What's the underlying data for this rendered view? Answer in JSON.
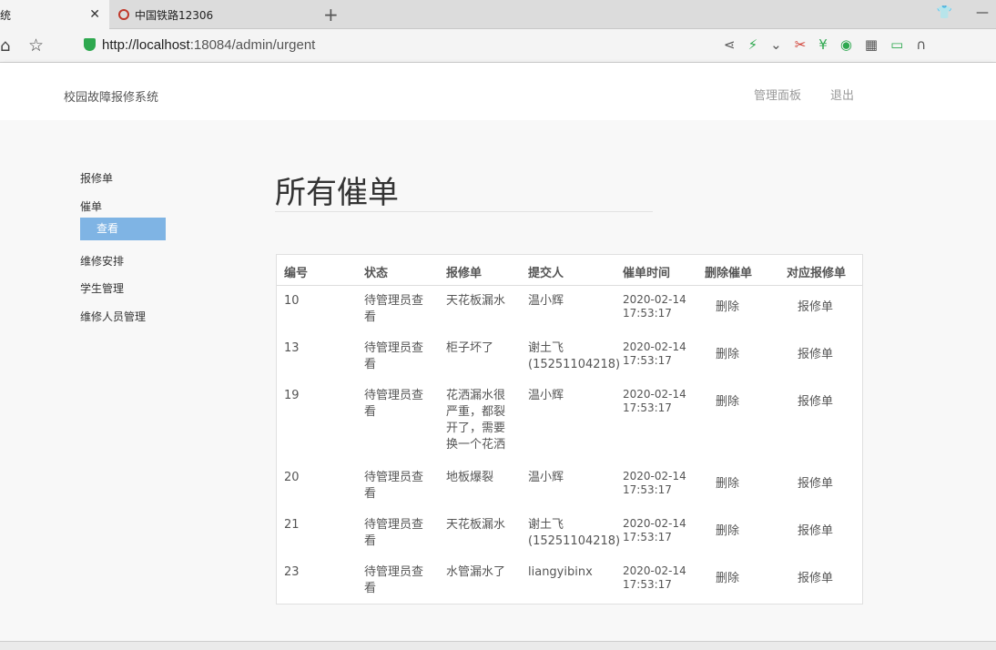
{
  "browser": {
    "active_tab_title": "统",
    "tab2_title": "中国铁路12306",
    "url_host": "http://localhost",
    "url_rest": ":18084/admin/urgent"
  },
  "navbar": {
    "brand": "校园故障报修系统",
    "admin_panel": "管理面板",
    "logout": "退出"
  },
  "sidebar": {
    "items": [
      "报修单",
      "催单",
      "维修安排",
      "学生管理",
      "维修人员管理"
    ],
    "sub_item": "查看"
  },
  "page": {
    "title": "所有催单"
  },
  "table": {
    "headers": [
      "编号",
      "状态",
      "报修单",
      "提交人",
      "催单时间",
      "删除催单",
      "对应报修单"
    ],
    "rows": [
      {
        "id": "10",
        "status": "待管理员查看",
        "issue": "天花板漏水",
        "submitter": "温小辉",
        "time": "2020-02-14 17:53:17",
        "delete": "删除",
        "link": "报修单"
      },
      {
        "id": "13",
        "status": "待管理员查看",
        "issue": "柜子坏了",
        "submitter": "谢土飞(15251104218)",
        "time": "2020-02-14 17:53:17",
        "delete": "删除",
        "link": "报修单"
      },
      {
        "id": "19",
        "status": "待管理员查看",
        "issue": "花洒漏水很严重，都裂开了，需要换一个花洒",
        "submitter": "温小辉",
        "time": "2020-02-14 17:53:17",
        "delete": "删除",
        "link": "报修单"
      },
      {
        "id": "20",
        "status": "待管理员查看",
        "issue": "地板爆裂",
        "submitter": "温小辉",
        "time": "2020-02-14 17:53:17",
        "delete": "删除",
        "link": "报修单"
      },
      {
        "id": "21",
        "status": "待管理员查看",
        "issue": "天花板漏水",
        "submitter": "谢土飞(15251104218)",
        "time": "2020-02-14 17:53:17",
        "delete": "删除",
        "link": "报修单"
      },
      {
        "id": "23",
        "status": "待管理员查看",
        "issue": "水管漏水了",
        "submitter": "liangyibinx",
        "time": "2020-02-14 17:53:17",
        "delete": "删除",
        "link": "报修单"
      }
    ]
  }
}
